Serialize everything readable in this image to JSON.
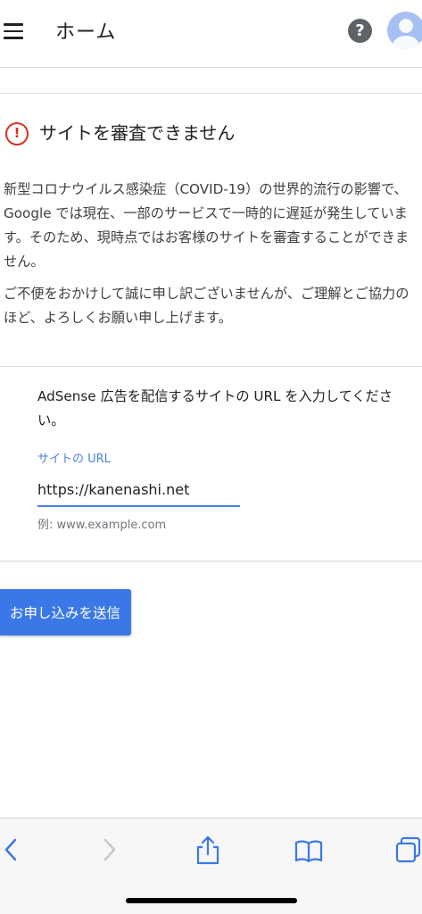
{
  "header": {
    "title": "ホーム",
    "help_symbol": "?",
    "icons": {
      "menu": "menu-icon",
      "help": "help-icon",
      "avatar": "account-avatar-icon"
    }
  },
  "review_card": {
    "alert_symbol": "!",
    "title": "サイトを審査できません",
    "paragraph1": "新型コロナウイルス感染症（COVID-19）の世界的流行の影響で、Google では現在、一部のサービスで一時的に遅延が発生しています。そのため、現時点ではお客様のサイトを審査することができません。",
    "paragraph2": "ご不便をおかけして誠に申し訳ございませんが、ご理解とご協力のほど、よろしくお願い申し上げます。"
  },
  "url_form": {
    "instruction": "AdSense 広告を配信するサイトの URL を入力してください。",
    "field_label": "サイトの URL",
    "field_value": "https://kanenashi.net",
    "hint": "例: www.example.com"
  },
  "actions": {
    "submit_label": "お申し込みを送信"
  },
  "browser_toolbar": {
    "icons": [
      "back-icon",
      "forward-icon",
      "share-icon",
      "bookmarks-icon",
      "tabs-icon"
    ]
  },
  "colors": {
    "accent": "#3b78e7",
    "alert": "#d93025",
    "field_accent": "#4a7fe0"
  }
}
